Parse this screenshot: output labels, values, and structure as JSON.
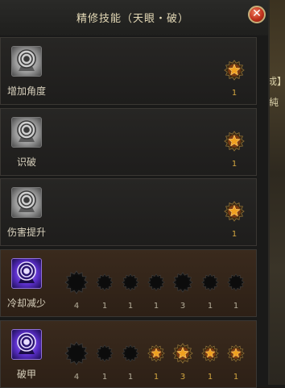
{
  "window": {
    "title": "精修技能（天眼・破）",
    "close_glyph": "✕"
  },
  "background_snippets": [
    "成】",
    "純"
  ],
  "colors": {
    "star_lit": "#f0a020",
    "star_dark": "#0c0c0c",
    "level_text": "#d3a640"
  },
  "skills": [
    {
      "name": "增加角度",
      "icon": "grey-target-icon",
      "row_style": "dark",
      "stars": [
        {
          "level": "1",
          "lit": true
        }
      ]
    },
    {
      "name": "识破",
      "icon": "grey-target-icon",
      "row_style": "dark",
      "stars": [
        {
          "level": "1",
          "lit": true
        }
      ]
    },
    {
      "name": "伤害提升",
      "icon": "grey-target-icon",
      "row_style": "dark",
      "stars": [
        {
          "level": "1",
          "lit": true
        }
      ]
    },
    {
      "name": "冷却减少",
      "icon": "purple-target-icon",
      "row_style": "brown",
      "stars": [
        {
          "level": "4",
          "lit": false,
          "size": "large"
        },
        {
          "level": "1",
          "lit": false,
          "size": "small"
        },
        {
          "level": "1",
          "lit": false,
          "size": "small"
        },
        {
          "level": "1",
          "lit": false,
          "size": "small"
        },
        {
          "level": "3",
          "lit": false,
          "size": "medium"
        },
        {
          "level": "1",
          "lit": false,
          "size": "small"
        },
        {
          "level": "1",
          "lit": false,
          "size": "small"
        }
      ]
    },
    {
      "name": "破甲",
      "icon": "purple-target-icon",
      "row_style": "brown",
      "stars": [
        {
          "level": "4",
          "lit": false,
          "size": "large"
        },
        {
          "level": "1",
          "lit": false,
          "size": "small"
        },
        {
          "level": "1",
          "lit": false,
          "size": "small"
        },
        {
          "level": "1",
          "lit": true,
          "size": "small"
        },
        {
          "level": "3",
          "lit": true,
          "size": "medium"
        },
        {
          "level": "1",
          "lit": true,
          "size": "small"
        },
        {
          "level": "1",
          "lit": true,
          "size": "small"
        }
      ]
    }
  ]
}
